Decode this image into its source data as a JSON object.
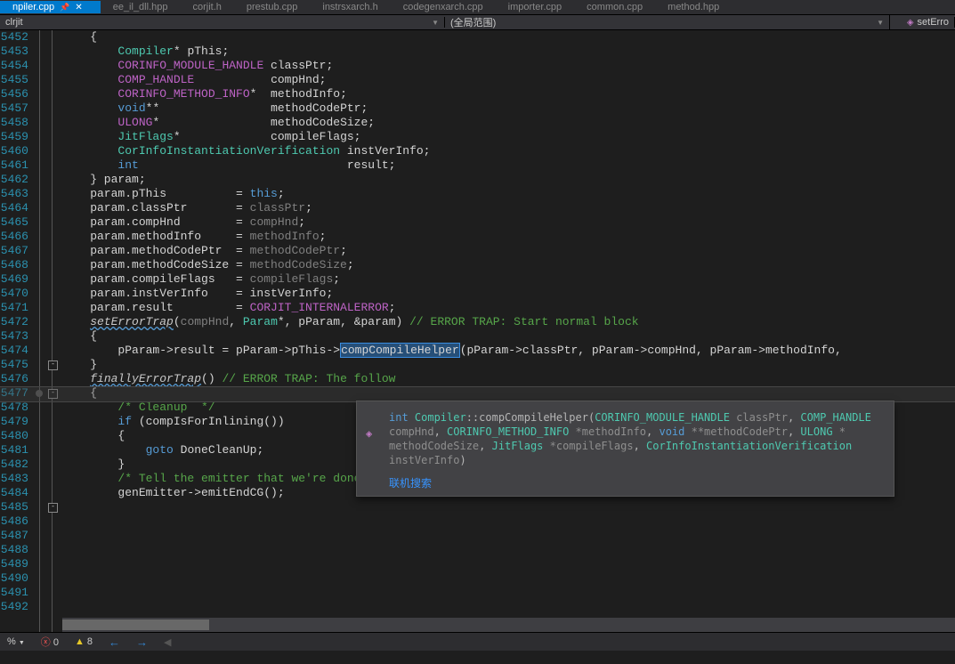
{
  "tabs": [
    {
      "label": "npiler.cpp",
      "active": true,
      "pinned": true,
      "close": true
    },
    {
      "label": "ee_il_dll.hpp"
    },
    {
      "label": "corjit.h"
    },
    {
      "label": "prestub.cpp"
    },
    {
      "label": "instrsxarch.h"
    },
    {
      "label": "codegenxarch.cpp"
    },
    {
      "label": "importer.cpp"
    },
    {
      "label": "common.cpp"
    },
    {
      "label": "method.hpp"
    }
  ],
  "breadcrumb": {
    "left": "clrjit",
    "mid": "(全局范围)",
    "right": "setErro"
  },
  "lines": {
    "first": 5452,
    "count": 41,
    "foldboxes": [
      5475,
      5477,
      5485
    ],
    "breakpoint_row": 5477,
    "highlight_row": 5477
  },
  "code": {
    "5452": [
      [
        "",
        "    {"
      ]
    ],
    "5453": [
      [
        "",
        "        "
      ],
      [
        "type",
        "Compiler"
      ],
      [
        "",
        "* pThis;"
      ]
    ],
    "5454": [
      [
        "",
        ""
      ]
    ],
    "5455": [
      [
        "",
        "        "
      ],
      [
        "macro",
        "CORINFO_MODULE_HANDLE"
      ],
      [
        "",
        " classPtr;"
      ]
    ],
    "5456": [
      [
        "",
        "        "
      ],
      [
        "macro",
        "COMP_HANDLE"
      ],
      [
        "",
        "           compHnd;"
      ]
    ],
    "5457": [
      [
        "",
        "        "
      ],
      [
        "macro",
        "CORINFO_METHOD_INFO"
      ],
      [
        "",
        "*  methodInfo;"
      ]
    ],
    "5458": [
      [
        "",
        "        "
      ],
      [
        "kw",
        "void"
      ],
      [
        "",
        "**                methodCodePtr;"
      ]
    ],
    "5459": [
      [
        "",
        "        "
      ],
      [
        "macro",
        "ULONG"
      ],
      [
        "",
        "*                methodCodeSize;"
      ]
    ],
    "5460": [
      [
        "",
        "        "
      ],
      [
        "type",
        "JitFlags"
      ],
      [
        "",
        "*             compileFlags;"
      ]
    ],
    "5461": [
      [
        "",
        ""
      ]
    ],
    "5462": [
      [
        "",
        "        "
      ],
      [
        "type",
        "CorInfoInstantiationVerification"
      ],
      [
        "",
        " instVerInfo;"
      ]
    ],
    "5463": [
      [
        "",
        "        "
      ],
      [
        "kw",
        "int"
      ],
      [
        "",
        "                              result;"
      ]
    ],
    "5464": [
      [
        "",
        "    } param;"
      ]
    ],
    "5465": [
      [
        "",
        "    param.pThis          = "
      ],
      [
        "kw",
        "this"
      ],
      [
        "",
        ";"
      ]
    ],
    "5466": [
      [
        "",
        "    param.classPtr       = "
      ],
      [
        "gray",
        "classPtr"
      ],
      [
        "",
        ";"
      ]
    ],
    "5467": [
      [
        "",
        "    param.compHnd        = "
      ],
      [
        "gray",
        "compHnd"
      ],
      [
        "",
        ";"
      ]
    ],
    "5468": [
      [
        "",
        "    param.methodInfo     = "
      ],
      [
        "gray",
        "methodInfo"
      ],
      [
        "",
        ";"
      ]
    ],
    "5469": [
      [
        "",
        "    param.methodCodePtr  = "
      ],
      [
        "gray",
        "methodCodePtr"
      ],
      [
        "",
        ";"
      ]
    ],
    "5470": [
      [
        "",
        "    param.methodCodeSize = "
      ],
      [
        "gray",
        "methodCodeSize"
      ],
      [
        "",
        ";"
      ]
    ],
    "5471": [
      [
        "",
        "    param.compileFlags   = "
      ],
      [
        "gray",
        "compileFlags"
      ],
      [
        "",
        ";"
      ]
    ],
    "5472": [
      [
        "",
        "    param.instVerInfo    = instVerInfo;"
      ]
    ],
    "5473": [
      [
        "",
        "    param.result         = "
      ],
      [
        "macro",
        "CORJIT_INTERNALERROR"
      ],
      [
        "",
        ";"
      ]
    ],
    "5474": [
      [
        "",
        ""
      ]
    ],
    "5475": [
      [
        "",
        "    "
      ],
      [
        "func",
        "setErrorTrap"
      ],
      [
        "",
        "("
      ],
      [
        "gray",
        "compHnd"
      ],
      [
        "",
        ", "
      ],
      [
        "type",
        "Param"
      ],
      [
        "",
        "*, pParam, &param) "
      ],
      [
        "cmt",
        "// ERROR TRAP: Start normal block"
      ]
    ],
    "5476": [
      [
        "",
        "    {"
      ]
    ],
    "5477": [
      [
        "",
        "        pParam->result = pParam->pThis->"
      ],
      [
        "sel",
        "compCompileHelper"
      ],
      [
        "",
        "(pParam->classPtr, pParam->compHnd, pParam->methodInfo,"
      ]
    ],
    "5478": [
      [
        "",
        ""
      ]
    ],
    "5479": [
      [
        "",
        ""
      ]
    ],
    "5480": [
      [
        "",
        "    }"
      ]
    ],
    "5481": [
      [
        "",
        "    "
      ],
      [
        "func",
        "finallyErrorTrap"
      ],
      [
        "",
        "() "
      ],
      [
        "cmt",
        "// ERROR TRAP: The follow"
      ]
    ],
    "5482": [
      [
        "",
        "    {"
      ]
    ],
    "5483": [
      [
        "",
        "        "
      ],
      [
        "cmt",
        "/* Cleanup  */"
      ]
    ],
    "5484": [
      [
        "",
        ""
      ]
    ],
    "5485": [
      [
        "",
        "        "
      ],
      [
        "kw",
        "if"
      ],
      [
        "",
        " (compIsForInlining())"
      ]
    ],
    "5486": [
      [
        "",
        "        {"
      ]
    ],
    "5487": [
      [
        "",
        "            "
      ],
      [
        "kw",
        "goto"
      ],
      [
        "",
        " DoneCleanUp;"
      ]
    ],
    "5488": [
      [
        "",
        "        }"
      ]
    ],
    "5489": [
      [
        "",
        ""
      ]
    ],
    "5490": [
      [
        "",
        "        "
      ],
      [
        "cmt",
        "/* Tell the emitter that we're done with this function */"
      ]
    ],
    "5491": [
      [
        "",
        ""
      ]
    ],
    "5492": [
      [
        "",
        "        genEmitter->emitEndCG();"
      ]
    ]
  },
  "tooltip": {
    "sig_parts": [
      [
        "tkw",
        "int "
      ],
      [
        "ttype",
        "Compiler"
      ],
      [
        "",
        "::compCompileHelper("
      ],
      [
        "ttype",
        "CORINFO_MODULE_HANDLE"
      ],
      [
        "tg",
        " classPtr"
      ],
      [
        "",
        ", "
      ],
      [
        "ttype",
        "COMP_HANDLE"
      ],
      [
        "tg",
        "\ncompHnd"
      ],
      [
        "",
        ", "
      ],
      [
        "ttype",
        "CORINFO_METHOD_INFO"
      ],
      [
        "tg",
        " *methodInfo"
      ],
      [
        "",
        ", "
      ],
      [
        "tkw",
        "void"
      ],
      [
        "tg",
        " **methodCodePtr"
      ],
      [
        "",
        ", "
      ],
      [
        "ttype",
        "ULONG"
      ],
      [
        "tg",
        " *\nmethodCodeSize"
      ],
      [
        "",
        ", "
      ],
      [
        "ttype",
        "JitFlags"
      ],
      [
        "tg",
        " *compileFlags"
      ],
      [
        "",
        ", "
      ],
      [
        "ttype",
        "CorInfoInstantiationVerification"
      ],
      [
        "tg",
        "\ninstVerInfo"
      ],
      [
        "",
        ")"
      ]
    ],
    "link": "联机搜索"
  },
  "status": {
    "zoom": "%",
    "errors": "0",
    "warnings": "8"
  }
}
